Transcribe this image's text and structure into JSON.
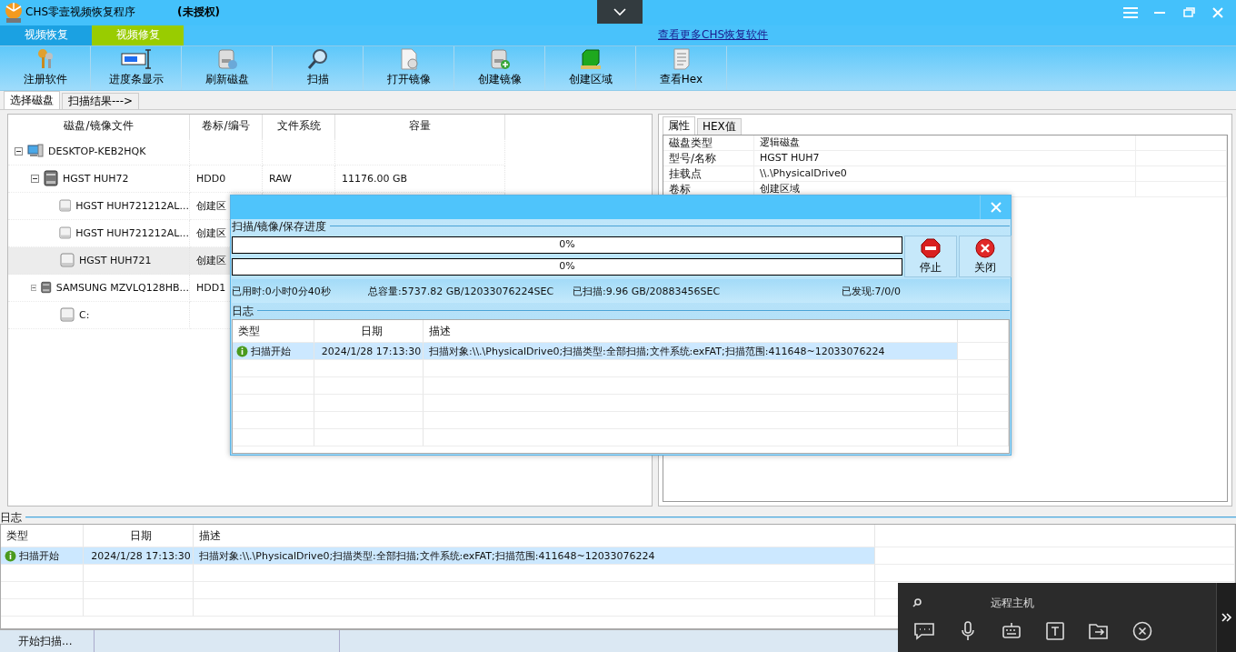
{
  "window": {
    "title": "CHS零壹视频恢复程序",
    "license": "(未授权)"
  },
  "top_tabs": [
    {
      "label": "视频恢复",
      "selected": false
    },
    {
      "label": "视频修复",
      "selected": true
    }
  ],
  "more_link": "查看更多CHS恢复软件",
  "toolbar": [
    {
      "kind": "register",
      "label": "注册软件"
    },
    {
      "kind": "progress",
      "label": "进度条显示"
    },
    {
      "kind": "refresh",
      "label": "刷新磁盘"
    },
    {
      "kind": "scan",
      "label": "扫描"
    },
    {
      "kind": "open",
      "label": "打开镜像"
    },
    {
      "kind": "create",
      "label": "创建镜像"
    },
    {
      "kind": "region",
      "label": "创建区域"
    },
    {
      "kind": "hex",
      "label": "查看Hex"
    }
  ],
  "view_tabs": [
    {
      "label": "选择磁盘",
      "selected": true
    },
    {
      "label": "扫描结果--->",
      "selected": false
    }
  ],
  "tree": {
    "columns": [
      "磁盘/镜像文件",
      "卷标/编号",
      "文件系统",
      "容量"
    ],
    "nodes": [
      {
        "kind": "computer",
        "name": "DESKTOP-KEB2HQK",
        "expanded": true,
        "selected": false,
        "children": [
          {
            "kind": "disk",
            "name": "HGST HUH72",
            "label": "HDD0",
            "filesystem": "RAW",
            "capacity": "11176.00 GB",
            "expanded": true,
            "selected": false,
            "children": [
              {
                "kind": "partition",
                "name": "HGST HUH721212AL...",
                "label": "创建区",
                "selected": false
              },
              {
                "kind": "partition",
                "name": "HGST HUH721212AL...",
                "label": "创建区",
                "selected": false
              },
              {
                "kind": "partition",
                "name": "HGST HUH721",
                "label": "创建区",
                "selected": true
              }
            ]
          },
          {
            "kind": "disk",
            "name": "SAMSUNG MZVLQ128HB...",
            "label": "HDD1",
            "expanded": true,
            "selected": false,
            "children": [
              {
                "kind": "partition",
                "name": "C:",
                "selected": false
              }
            ]
          }
        ]
      }
    ]
  },
  "properties": {
    "tabs": [
      {
        "label": "属性",
        "selected": true
      },
      {
        "label": "HEX值",
        "selected": false
      }
    ],
    "rows": [
      {
        "name": "磁盘类型",
        "value": "逻辑磁盘"
      },
      {
        "name": "型号/名称",
        "value": "HGST HUH7"
      },
      {
        "name": "挂载点",
        "value": "\\\\.\\PhysicalDrive0"
      },
      {
        "name": "卷标",
        "value": "创建区域"
      }
    ]
  },
  "dialog": {
    "section_title": "扫描/镜像/保存进度",
    "progress": [
      {
        "level": 0,
        "reading": "0%"
      },
      {
        "level": 0,
        "reading": "0%"
      }
    ],
    "buttons": [
      {
        "kind": "stop",
        "label": "停止"
      },
      {
        "kind": "close",
        "label": "关闭"
      }
    ],
    "stats": [
      "已用时:0小时0分40秒",
      "总容量:5737.82 GB/12033076224SEC",
      "已扫描:9.96 GB/20883456SEC",
      "已发现:7/0/0"
    ],
    "log_title": "日志",
    "log": {
      "columns": [
        "类型",
        "日期",
        "描述"
      ],
      "rows": [
        {
          "type": "扫描开始",
          "date": "2024/1/28 17:13:30",
          "description": "扫描对象:\\\\.\\PhysicalDrive0;扫描类型:全部扫描;文件系统:exFAT;扫描范围:411648~12033076224",
          "selected": true
        }
      ]
    }
  },
  "log_title": "日志",
  "log": {
    "columns": [
      "类型",
      "日期",
      "描述"
    ],
    "rows": [
      {
        "type": "扫描开始",
        "date": "2024/1/28 17:13:30",
        "description": "扫描对象:\\\\.\\PhysicalDrive0;扫描类型:全部扫描;文件系统:exFAT;扫描范围:411648~12033076224",
        "selected": true
      }
    ]
  },
  "status_bar": [
    "开始扫描..."
  ],
  "remote_panel": {
    "host": "远程主机"
  }
}
